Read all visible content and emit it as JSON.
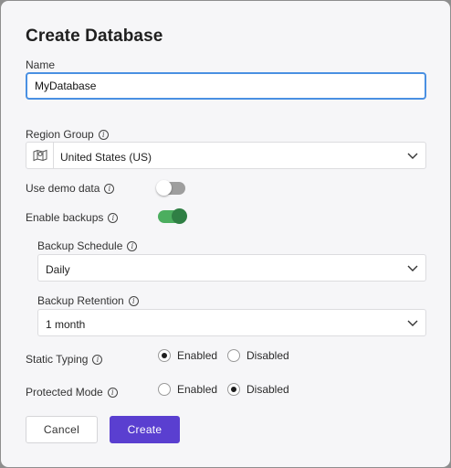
{
  "dialog": {
    "title": "Create Database"
  },
  "name": {
    "label": "Name",
    "value": "MyDatabase"
  },
  "region": {
    "label": "Region Group",
    "selected": "United States (US)",
    "icon": "map-icon"
  },
  "demo": {
    "label": "Use demo data",
    "enabled": false
  },
  "backups": {
    "label": "Enable backups",
    "enabled": true,
    "schedule": {
      "label": "Backup Schedule",
      "selected": "Daily"
    },
    "retention": {
      "label": "Backup Retention",
      "selected": "1 month"
    }
  },
  "static_typing": {
    "label": "Static Typing",
    "options": [
      "Enabled",
      "Disabled"
    ],
    "selected": "Enabled"
  },
  "protected_mode": {
    "label": "Protected Mode",
    "options": [
      "Enabled",
      "Disabled"
    ],
    "selected": "Disabled"
  },
  "info_glyph": "i",
  "buttons": {
    "cancel": "Cancel",
    "create": "Create"
  },
  "colors": {
    "accent": "#5a3fd0",
    "toggle_on": "#4cae5f",
    "focus": "#4a90e2"
  }
}
